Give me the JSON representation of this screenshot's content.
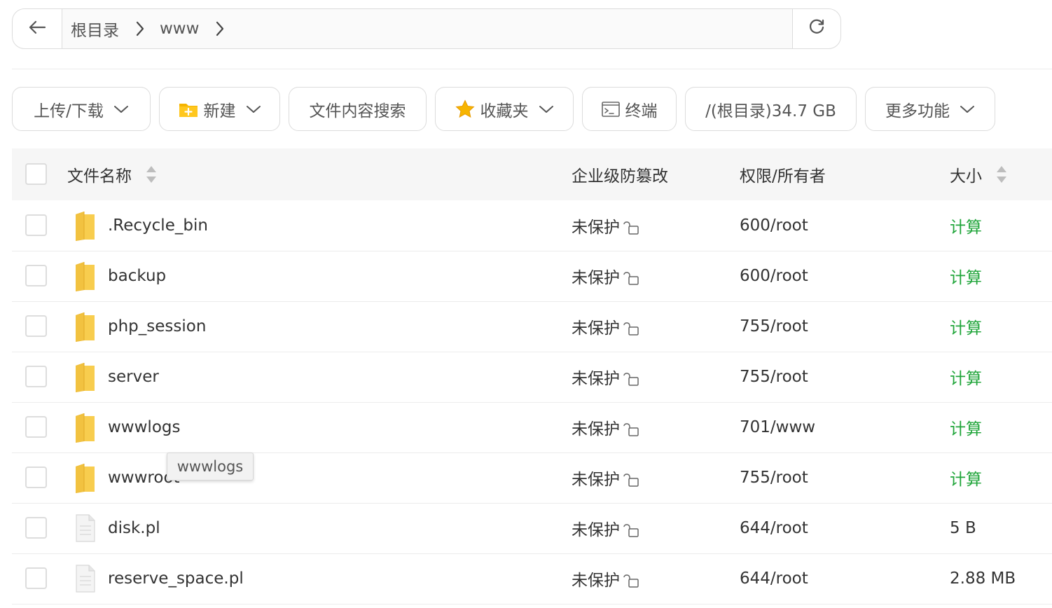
{
  "address_bar": {
    "crumbs": [
      "根目录",
      "www"
    ],
    "icons": {
      "back": "arrow-left-icon",
      "refresh": "refresh-icon"
    }
  },
  "toolbar": {
    "upload_download": "上传/下载",
    "new": "新建",
    "content_search": "文件内容搜索",
    "favorites": "收藏夹",
    "terminal": "终端",
    "disk": "/(根目录)34.7 GB",
    "more": "更多功能"
  },
  "table": {
    "headers": {
      "name": "文件名称",
      "protection": "企业级防篡改",
      "permission": "权限/所有者",
      "size": "大小"
    },
    "rows": [
      {
        "type": "folder",
        "name": ".Recycle_bin",
        "protection": "未保护",
        "permission": "600/root",
        "size": "计算"
      },
      {
        "type": "folder",
        "name": "backup",
        "protection": "未保护",
        "permission": "600/root",
        "size": "计算"
      },
      {
        "type": "folder",
        "name": "php_session",
        "protection": "未保护",
        "permission": "755/root",
        "size": "计算"
      },
      {
        "type": "folder",
        "name": "server",
        "protection": "未保护",
        "permission": "755/root",
        "size": "计算"
      },
      {
        "type": "folder",
        "name": "wwwlogs",
        "protection": "未保护",
        "permission": "701/www",
        "size": "计算"
      },
      {
        "type": "folder",
        "name": "wwwroot",
        "protection": "未保护",
        "permission": "755/root",
        "size": "计算"
      },
      {
        "type": "file",
        "name": "disk.pl",
        "protection": "未保护",
        "permission": "644/root",
        "size": "5 B"
      },
      {
        "type": "file",
        "name": "reserve_space.pl",
        "protection": "未保护",
        "permission": "644/root",
        "size": "2.88 MB"
      }
    ]
  },
  "tooltip": {
    "text": "wwwlogs"
  },
  "colors": {
    "accent_green": "#20a53a",
    "folder": "#f5c842",
    "border": "#dcdcdc"
  }
}
